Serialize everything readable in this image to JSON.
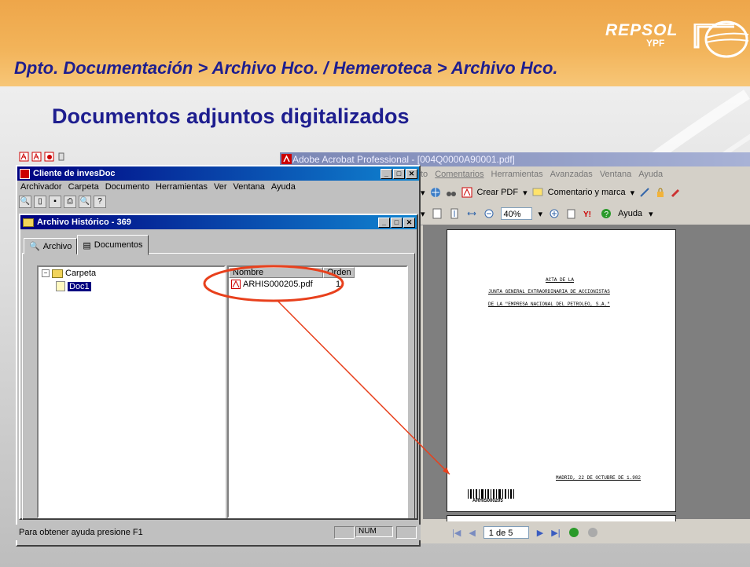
{
  "header": {
    "breadcrumb": "Dpto. Documentación > Archivo Hco. / Hemeroteca > Archivo Hco.",
    "logo_brand": "REPSOL",
    "logo_sub": "YPF",
    "accent_color": "#f2b359",
    "title_color": "#1e1e8f"
  },
  "slide_title": "Documentos adjuntos digitalizados",
  "acrobat": {
    "title": "Adobe Acrobat Professional - [004Q0000A90001.pdf]",
    "menu": [
      "to",
      "Comentarios",
      "Herramientas",
      "Avanzadas",
      "Ventana",
      "Ayuda"
    ],
    "toolbar": {
      "create_pdf": "Crear PDF",
      "comment": "Comentario y marca",
      "zoom": "40%",
      "help": "Ayuda"
    },
    "page": {
      "line1": "ACTA DE LA",
      "line2": "JUNTA GENERAL EXTRAORDINARIA DE ACCIONISTAS",
      "line3": "DE LA \"EMPRESA NACIONAL DEL PETROLEO, S.A.\"",
      "date_line": "MADRID, 22 DE OCTUBRE DE 1.982",
      "barcode_label": "ARHIS000205"
    },
    "status": {
      "page_of": "1 de 5"
    }
  },
  "invesdoc": {
    "title": "Cliente de invesDoc",
    "menu": [
      "Archivador",
      "Carpeta",
      "Documento",
      "Herramientas",
      "Ver",
      "Ventana",
      "Ayuda"
    ],
    "child_title": "Archivo Histórico - 369",
    "tabs": [
      "Archivo",
      "Documentos"
    ],
    "tree": {
      "root": "Carpeta",
      "child": "Doc1"
    },
    "list": {
      "columns": [
        "Nombre",
        "Orden"
      ],
      "rows": [
        {
          "name": "ARHIS000205.pdf",
          "order": "1"
        }
      ]
    },
    "status_text": "Para obtener ayuda presione F1",
    "status_num": "NUM"
  }
}
